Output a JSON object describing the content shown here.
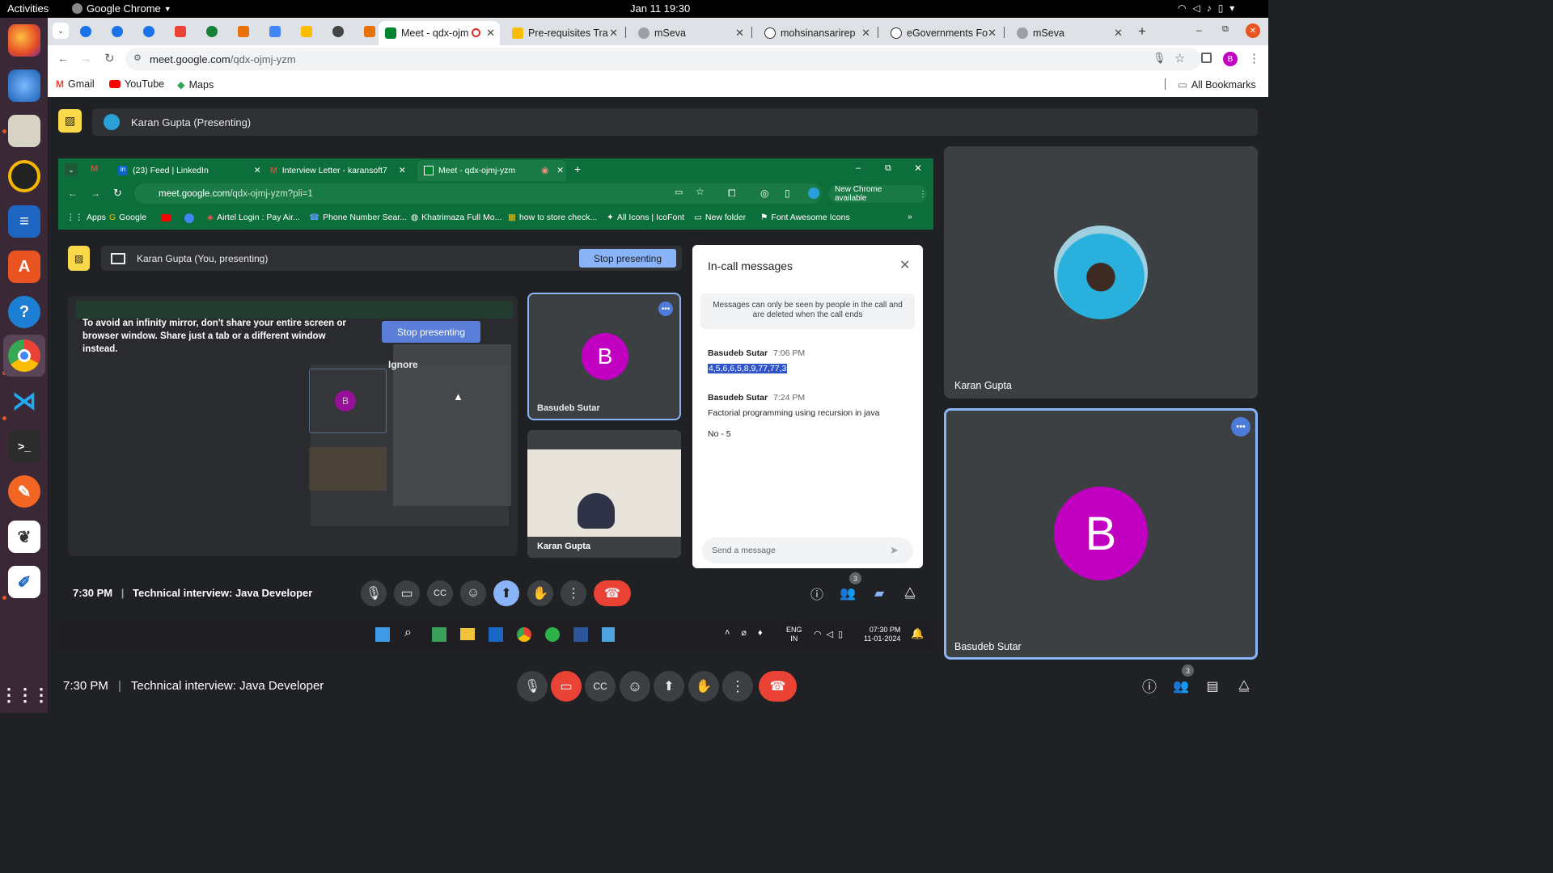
{
  "system_bar": {
    "activities": "Activities",
    "app_name": "Google Chrome",
    "clock": "Jan 11  19:30"
  },
  "browser": {
    "tabs": [
      {
        "label": "Meet - qdx-ojm",
        "active": true
      },
      {
        "label": "Pre-requisites Tra"
      },
      {
        "label": "mSeva"
      },
      {
        "label": "mohsinansarirep"
      },
      {
        "label": "eGovernments Fo"
      },
      {
        "label": "mSeva"
      }
    ],
    "url_host": "meet.google.com",
    "url_path": "/qdx-ojmj-yzm",
    "profile_initial": "B",
    "bookmarks": [
      {
        "label": "Gmail"
      },
      {
        "label": "YouTube"
      },
      {
        "label": "Maps"
      }
    ],
    "all_bookmarks": "All Bookmarks"
  },
  "meet": {
    "presenter_bar": "Karan Gupta (Presenting)",
    "participants": [
      {
        "name": "Karan Gupta"
      },
      {
        "name": "Basudeb Sutar",
        "initial": "B"
      }
    ],
    "time": "7:30 PM",
    "divider": "|",
    "meeting_title": "Technical interview: Java Developer",
    "people_count": "3"
  },
  "shared_screen": {
    "tabs": [
      {
        "label": "(23) Feed | LinkedIn"
      },
      {
        "label": "Interview Letter - karansoft7"
      },
      {
        "label": "Meet - qdx-ojmj-yzm"
      }
    ],
    "url_host": "meet.google.com",
    "url_path": "/qdx-ojmj-yzm?pli=1",
    "new_chrome": "New Chrome available",
    "bookmarks": [
      "Apps",
      "Google",
      "Airtel Login : Pay Air...",
      "Phone Number Sear...",
      "Khatrimaza Full Mo...",
      "how to store check...",
      "All Icons | IcoFont",
      "New folder",
      "Font Awesome Icons"
    ],
    "presenting_bar": "Karan Gupta (You, presenting)",
    "stop_presenting": "Stop presenting",
    "mirror_warning": "To avoid an infinity mirror, don't share your entire screen or browser window. Share just a tab or a different window instead.",
    "stop_presenting_2": "Stop presenting",
    "ignore": "Ignore",
    "tile_basudeb": "Basudeb Sutar",
    "tile_basudeb_initial": "B",
    "tile_karan": "Karan Gupta",
    "chat": {
      "title": "In-call messages",
      "notice": "Messages can only be seen by people in the call and are deleted when the call ends",
      "messages": [
        {
          "sender": "Basudeb Sutar",
          "time": "7:06 PM",
          "text": "4,5,6,6,5,8,9,77,77,3"
        },
        {
          "sender": "Basudeb Sutar",
          "time": "7:24 PM",
          "text": "Factorial programming using recursion in java"
        },
        {
          "sender": "",
          "time": "",
          "text": "No - 5"
        }
      ],
      "placeholder": "Send a message"
    },
    "time": "7:30 PM",
    "divider": "|",
    "meeting_title": "Technical interview: Java Developer",
    "people_count": "3",
    "taskbar": {
      "lang_top": "ENG",
      "lang_bottom": "IN",
      "time": "07:30 PM",
      "date": "11-01-2024"
    }
  },
  "colors": {
    "accent": "#8ab4f8",
    "end_call": "#ea4335",
    "avatar": "#c100c1",
    "inner_chrome": "#0c6e3a"
  }
}
